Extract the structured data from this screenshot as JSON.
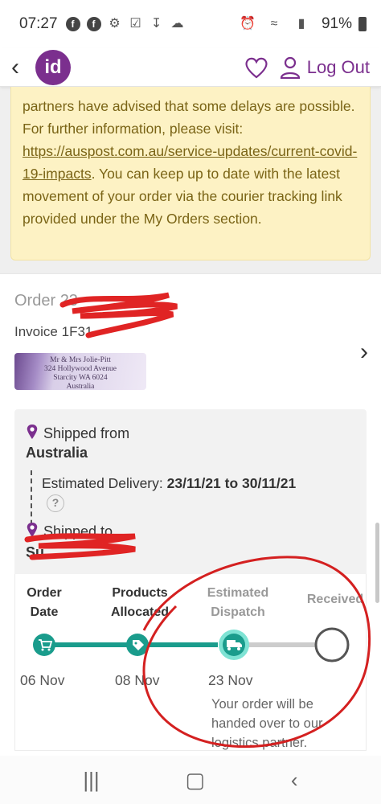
{
  "status_bar": {
    "time": "07:27",
    "battery": "91%"
  },
  "header": {
    "back_icon": "chevron-left-icon",
    "logo_text": "id",
    "logout_label": "Log Out",
    "brand_color": "#7b2f8e"
  },
  "notice": {
    "text_before": "partners have advised that some delays are possible. For further information, please visit: ",
    "link": "https://auspost.com.au/service-updates/current-covid-19-impacts",
    "text_after": ". You can keep up to date with the latest movement of your order via the courier tracking link provided under the My Orders section."
  },
  "order": {
    "order_label": "Order",
    "order_value": "23",
    "invoice_label": "Invoice",
    "invoice_value": "1F31",
    "address_label": [
      "Mr & Mrs Jolie-Pitt",
      "324 Hollywood Avenue",
      "Starcity WA 6024",
      "Australia"
    ]
  },
  "shipping": {
    "from_label": "Shipped from",
    "from_value": "Australia",
    "est_label": "Estimated Delivery:",
    "est_value": "23/11/21 to 30/11/21",
    "help": "?",
    "to_label": "Shipped to",
    "to_value": "Su"
  },
  "timeline": {
    "steps": [
      {
        "label_1": "Order",
        "label_2": "Date",
        "date": "06 Nov"
      },
      {
        "label_1": "Products",
        "label_2": "Allocated",
        "date": "08 Nov"
      },
      {
        "label_1": "Estimated",
        "label_2": "Dispatch",
        "date": "23 Nov"
      },
      {
        "label_1": "Received",
        "label_2": "",
        "date": ""
      }
    ],
    "note": "Your order will be handed over to our logistics partner.",
    "colors": {
      "done": "#1a9c8c",
      "current_ring": "#7fe3d4",
      "pending": "#cccccc",
      "annotation": "#d42020"
    }
  }
}
